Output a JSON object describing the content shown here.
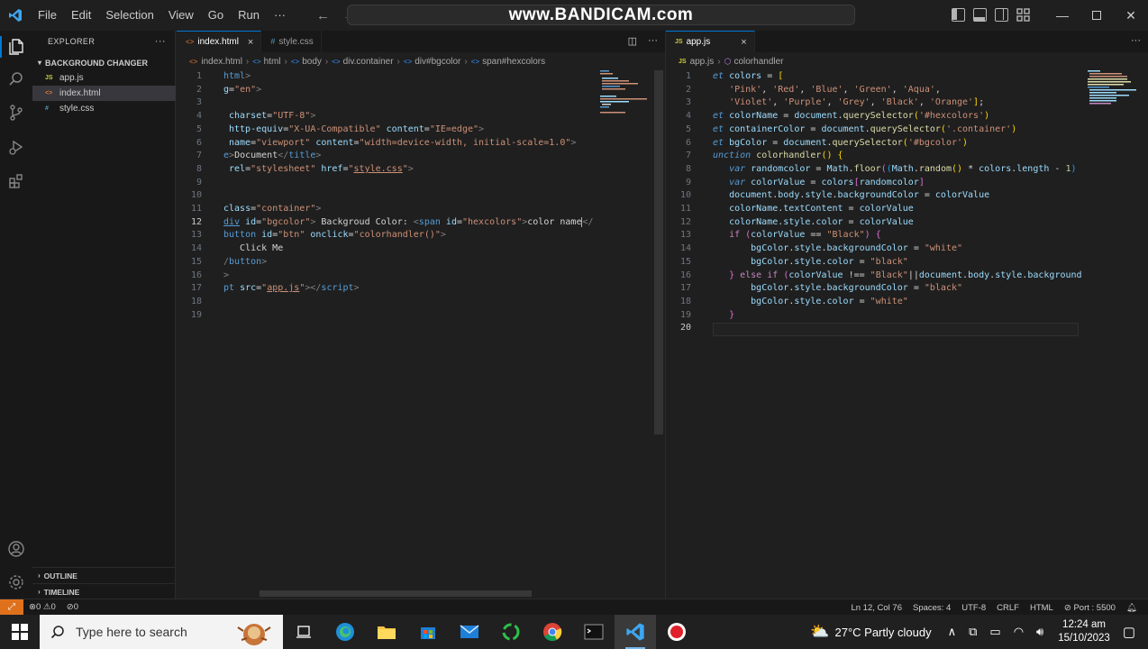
{
  "watermark": "www.BANDICAM.com",
  "menu": [
    "File",
    "Edit",
    "Selection",
    "View",
    "Go",
    "Run",
    "···"
  ],
  "explorer": {
    "title": "EXPLORER",
    "more": "···",
    "folder": "BACKGROUND CHANGER",
    "files": [
      {
        "icon": "JS",
        "name": "app.js"
      },
      {
        "icon": "<>",
        "name": "index.html"
      },
      {
        "icon": "#",
        "name": "style.css"
      }
    ],
    "outline": "OUTLINE",
    "timeline": "TIMELINE"
  },
  "left_editor": {
    "tabs": [
      {
        "label": "index.html",
        "close": "×"
      },
      {
        "label": "style.css"
      }
    ],
    "breadcrumb": [
      "index.html",
      "html",
      "body",
      "div.container",
      "div#bgcolor",
      "span#hexcolors"
    ],
    "line_numbers": [
      "1",
      "2",
      "3",
      "4",
      "5",
      "6",
      "7",
      "8",
      "9",
      "10",
      "11",
      "12",
      "13",
      "14",
      "15",
      "16",
      "17",
      "18",
      "19"
    ],
    "current_line": "12"
  },
  "right_editor": {
    "tabs": [
      {
        "label": "app.js",
        "close": "×"
      }
    ],
    "breadcrumb": [
      "app.js",
      "colorhandler"
    ],
    "line_numbers": [
      "1",
      "2",
      "3",
      "4",
      "5",
      "6",
      "7",
      "8",
      "9",
      "10",
      "11",
      "12",
      "13",
      "14",
      "15",
      "16",
      "17",
      "18",
      "19",
      "20"
    ]
  },
  "status": {
    "errors": "0",
    "warnings": "0",
    "ports": "0",
    "position": "Ln 12, Col 76",
    "spaces": "Spaces: 4",
    "encoding": "UTF-8",
    "eol": "CRLF",
    "language": "HTML",
    "port": "Port : 5500"
  },
  "taskbar": {
    "search_placeholder": "Type here to search",
    "weather": "27°C  Partly cloudy",
    "time": "12:24 am",
    "date": "15/10/2023"
  }
}
